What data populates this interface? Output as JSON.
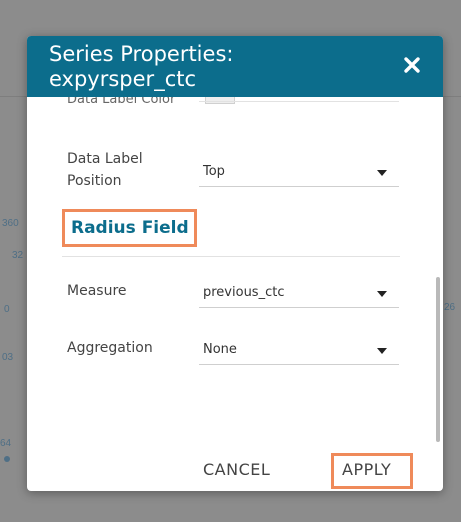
{
  "background": {
    "fragments": [
      "360",
      "32",
      "0",
      "03",
      "64",
      "26"
    ]
  },
  "dialog": {
    "title": "Series Properties: expyrsper_ctc",
    "close_icon": "close-icon",
    "partial_label": "Data Label Color",
    "data_label_position": {
      "label": "Data Label Position",
      "value": "Top"
    },
    "section_title": "Radius Field",
    "measure": {
      "label": "Measure",
      "value": "previous_ctc"
    },
    "aggregation": {
      "label": "Aggregation",
      "value": "None"
    },
    "footer": {
      "cancel_label": "CANCEL",
      "apply_label": "APPLY"
    }
  },
  "colors": {
    "header_bg": "#0c6d8c",
    "accent": "#0c6d8c",
    "highlight": "#ef8a5a"
  }
}
